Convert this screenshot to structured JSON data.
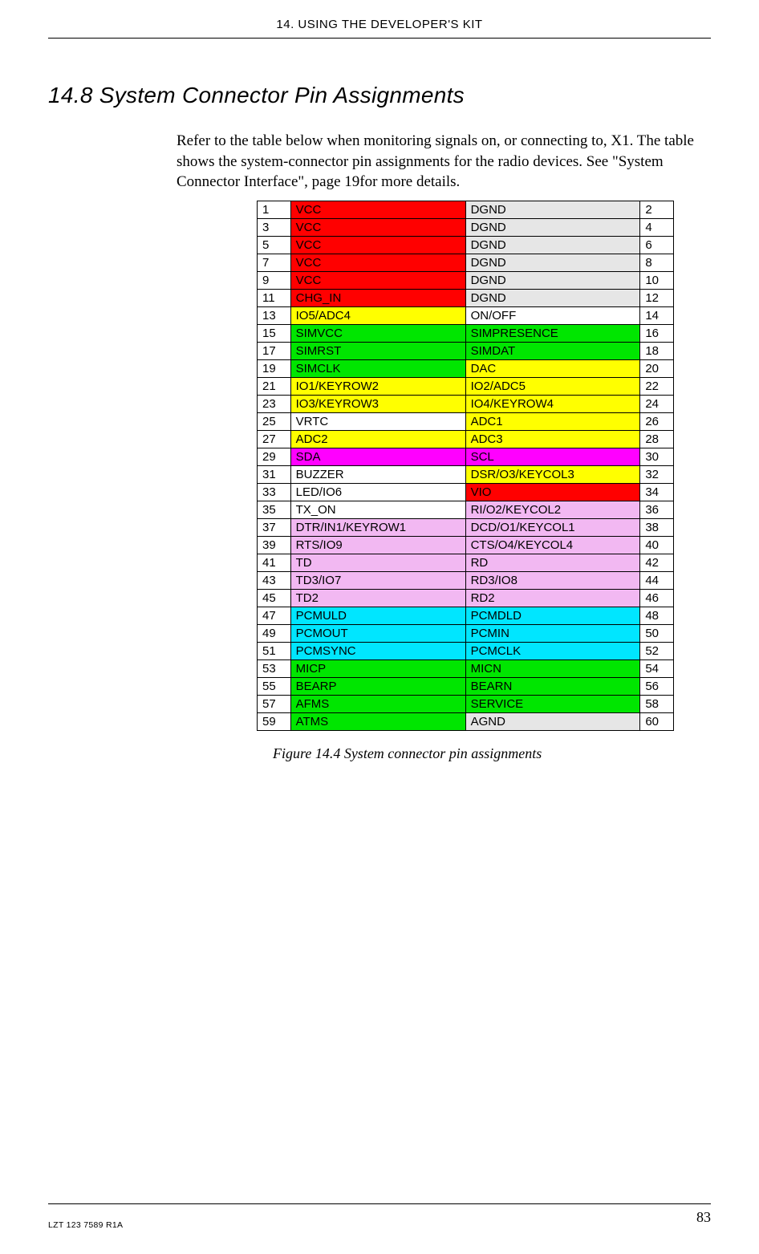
{
  "header": "14. USING THE DEVELOPER'S KIT",
  "section_heading": "14.8 System Connector Pin Assignments",
  "intro": "Refer to the table below when monitoring signals on, or connecting to, X1. The table shows the system-connector pin assignments for the radio devices. See \"System Connector Interface\", page 19for more details.",
  "caption": "Figure 14.4  System connector pin assignments",
  "footer_left": "LZT 123 7589 R1A",
  "footer_right": "83",
  "colors": {
    "red": "#ff0000",
    "grey": "#e6e6e6",
    "yellow": "#ffff00",
    "green": "#00e600",
    "magenta": "#ff00ff",
    "pink": "#f2b8f2",
    "cyan": "#00e6ff",
    "white": "#ffffff"
  },
  "rows": [
    {
      "l_num": "1",
      "l_sig": "VCC",
      "l_color": "red",
      "r_sig": "DGND",
      "r_color": "grey",
      "r_num": "2"
    },
    {
      "l_num": "3",
      "l_sig": "VCC",
      "l_color": "red",
      "r_sig": "DGND",
      "r_color": "grey",
      "r_num": "4"
    },
    {
      "l_num": "5",
      "l_sig": "VCC",
      "l_color": "red",
      "r_sig": "DGND",
      "r_color": "grey",
      "r_num": "6"
    },
    {
      "l_num": "7",
      "l_sig": "VCC",
      "l_color": "red",
      "r_sig": "DGND",
      "r_color": "grey",
      "r_num": "8"
    },
    {
      "l_num": "9",
      "l_sig": "VCC",
      "l_color": "red",
      "r_sig": "DGND",
      "r_color": "grey",
      "r_num": "10"
    },
    {
      "l_num": "11",
      "l_sig": "CHG_IN",
      "l_color": "red",
      "r_sig": "DGND",
      "r_color": "grey",
      "r_num": "12"
    },
    {
      "l_num": "13",
      "l_sig": "IO5/ADC4",
      "l_color": "yellow",
      "r_sig": "ON/OFF",
      "r_color": "white",
      "r_num": "14"
    },
    {
      "l_num": "15",
      "l_sig": "SIMVCC",
      "l_color": "green",
      "r_sig": "SIMPRESENCE",
      "r_color": "green",
      "r_num": "16"
    },
    {
      "l_num": "17",
      "l_sig": "SIMRST",
      "l_color": "green",
      "r_sig": "SIMDAT",
      "r_color": "green",
      "r_num": "18"
    },
    {
      "l_num": "19",
      "l_sig": "SIMCLK",
      "l_color": "green",
      "r_sig": "DAC",
      "r_color": "yellow",
      "r_num": "20"
    },
    {
      "l_num": "21",
      "l_sig": "IO1/KEYROW2",
      "l_color": "yellow",
      "r_sig": "IO2/ADC5",
      "r_color": "yellow",
      "r_num": "22"
    },
    {
      "l_num": "23",
      "l_sig": "IO3/KEYROW3",
      "l_color": "yellow",
      "r_sig": "IO4/KEYROW4",
      "r_color": "yellow",
      "r_num": "24"
    },
    {
      "l_num": "25",
      "l_sig": "VRTC",
      "l_color": "white",
      "r_sig": "ADC1",
      "r_color": "yellow",
      "r_num": "26"
    },
    {
      "l_num": "27",
      "l_sig": "ADC2",
      "l_color": "yellow",
      "r_sig": "ADC3",
      "r_color": "yellow",
      "r_num": "28"
    },
    {
      "l_num": "29",
      "l_sig": "SDA",
      "l_color": "magenta",
      "r_sig": "SCL",
      "r_color": "magenta",
      "r_num": "30"
    },
    {
      "l_num": "31",
      "l_sig": "BUZZER",
      "l_color": "white",
      "r_sig": "DSR/O3/KEYCOL3",
      "r_color": "yellow",
      "r_num": "32"
    },
    {
      "l_num": "33",
      "l_sig": "LED/IO6",
      "l_color": "white",
      "r_sig": "VIO",
      "r_color": "red",
      "r_num": "34"
    },
    {
      "l_num": "35",
      "l_sig": "TX_ON",
      "l_color": "white",
      "r_sig": "RI/O2/KEYCOL2",
      "r_color": "pink",
      "r_num": "36"
    },
    {
      "l_num": "37",
      "l_sig": "DTR/IN1/KEYROW1",
      "l_color": "pink",
      "r_sig": "DCD/O1/KEYCOL1",
      "r_color": "pink",
      "r_num": "38"
    },
    {
      "l_num": "39",
      "l_sig": "RTS/IO9",
      "l_color": "pink",
      "r_sig": "CTS/O4/KEYCOL4",
      "r_color": "pink",
      "r_num": "40"
    },
    {
      "l_num": "41",
      "l_sig": "TD",
      "l_color": "pink",
      "r_sig": "RD",
      "r_color": "pink",
      "r_num": "42"
    },
    {
      "l_num": "43",
      "l_sig": "TD3/IO7",
      "l_color": "pink",
      "r_sig": "RD3/IO8",
      "r_color": "pink",
      "r_num": "44"
    },
    {
      "l_num": "45",
      "l_sig": "TD2",
      "l_color": "pink",
      "r_sig": "RD2",
      "r_color": "pink",
      "r_num": "46"
    },
    {
      "l_num": "47",
      "l_sig": "PCMULD",
      "l_color": "cyan",
      "r_sig": "PCMDLD",
      "r_color": "cyan",
      "r_num": "48"
    },
    {
      "l_num": "49",
      "l_sig": "PCMOUT",
      "l_color": "cyan",
      "r_sig": "PCMIN",
      "r_color": "cyan",
      "r_num": "50"
    },
    {
      "l_num": "51",
      "l_sig": "PCMSYNC",
      "l_color": "cyan",
      "r_sig": "PCMCLK",
      "r_color": "cyan",
      "r_num": "52"
    },
    {
      "l_num": "53",
      "l_sig": "MICP",
      "l_color": "green",
      "r_sig": "MICN",
      "r_color": "green",
      "r_num": "54"
    },
    {
      "l_num": "55",
      "l_sig": "BEARP",
      "l_color": "green",
      "r_sig": "BEARN",
      "r_color": "green",
      "r_num": "56"
    },
    {
      "l_num": "57",
      "l_sig": "AFMS",
      "l_color": "green",
      "r_sig": "SERVICE",
      "r_color": "green",
      "r_num": "58"
    },
    {
      "l_num": "59",
      "l_sig": "ATMS",
      "l_color": "green",
      "r_sig": "AGND",
      "r_color": "grey",
      "r_num": "60"
    }
  ]
}
